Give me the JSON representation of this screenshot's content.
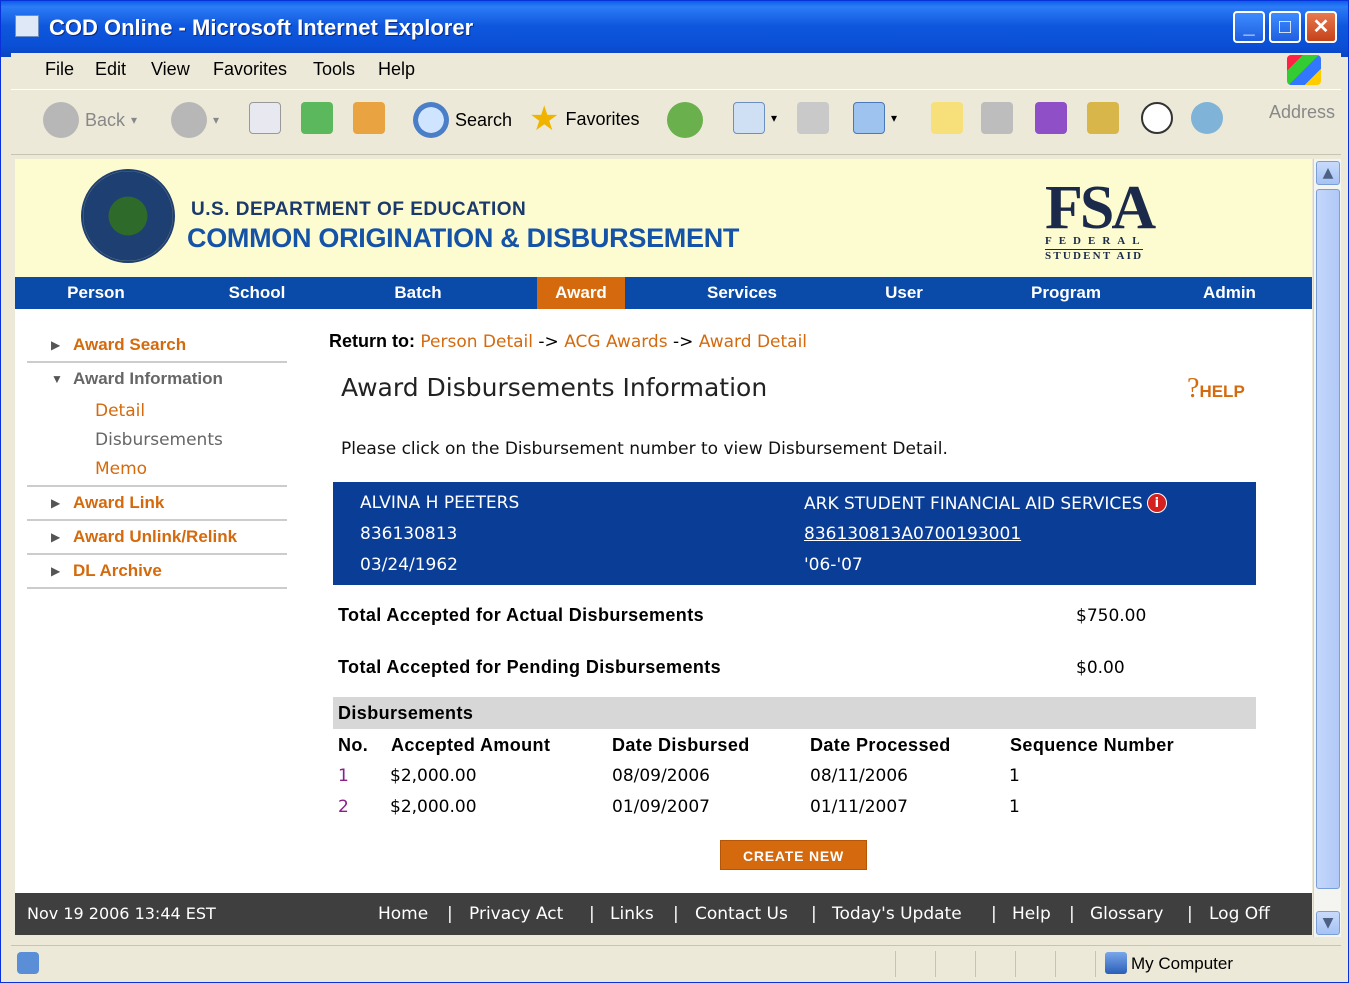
{
  "window": {
    "title": "COD Online - Microsoft Internet Explorer",
    "controls": [
      "minimize",
      "maximize",
      "close"
    ]
  },
  "menubar": {
    "items": [
      "File",
      "Edit",
      "View",
      "Favorites",
      "Tools",
      "Help"
    ]
  },
  "toolbar": {
    "back_label": "Back",
    "search_label": "Search",
    "favorites_label": "Favorites",
    "address_label": "Address"
  },
  "banner": {
    "department": "U.S. DEPARTMENT OF EDUCATION",
    "system_name": "COMMON ORIGINATION & DISBURSEMENT",
    "logo": {
      "big": "FSA",
      "line1": "FEDERAL",
      "line2": "STUDENT AID"
    }
  },
  "nav": {
    "items": [
      {
        "label": "Person"
      },
      {
        "label": "School"
      },
      {
        "label": "Batch"
      },
      {
        "label": "Award"
      },
      {
        "label": "Services"
      },
      {
        "label": "User"
      },
      {
        "label": "Program"
      },
      {
        "label": "Admin"
      }
    ],
    "active": "Award"
  },
  "sidebar": {
    "award_search": "Award Search",
    "award_information": "Award Information",
    "sub": [
      "Detail",
      "Disbursements",
      "Memo"
    ],
    "award_link": "Award Link",
    "award_unlink": "Award Unlink/Relink",
    "dl_archive": "DL Archive"
  },
  "breadcrumb": {
    "prefix": "Return to:",
    "items": [
      "Person Detail",
      "ACG Awards",
      "Award Detail"
    ],
    "separator": "->"
  },
  "page": {
    "title": "Award Disbursements Information",
    "help": "HELP",
    "instructions": "Please click on the Disbursement number to view Disbursement Detail."
  },
  "student": {
    "name": "ALVINA H PEETERS",
    "ssn": "836130813",
    "dob": "03/24/1962",
    "school": "ARK STUDENT FINANCIAL AID SERVICES",
    "award_id": "836130813A0700193001",
    "award_year": "'06-'07"
  },
  "totals": {
    "actual_label": "Total Accepted for Actual Disbursements",
    "actual_value": "$750.00",
    "pending_label": "Total Accepted for Pending Disbursements",
    "pending_value": "$0.00"
  },
  "disbursements": {
    "header": "Disbursements",
    "columns": [
      "No.",
      "Accepted Amount",
      "Date Disbursed",
      "Date Processed",
      "Sequence Number"
    ],
    "rows": [
      [
        "1",
        "$2,000.00",
        "08/09/2006",
        "08/11/2006",
        "1"
      ],
      [
        "2",
        "$2,000.00",
        "01/09/2007",
        "01/11/2007",
        "1"
      ]
    ],
    "create_label": "CREATE NEW"
  },
  "footer": {
    "timestamp": "Nov 19 2006 13:44 EST",
    "links": [
      "Home",
      "Privacy Act",
      "Links",
      "Contact Us",
      "Today's Update",
      "Help",
      "Glossary",
      "Log Off"
    ]
  },
  "statusbar": {
    "zone": "My Computer"
  },
  "colors": {
    "nav_bg": "#0a4aa8",
    "accent_orange": "#d46a0d",
    "student_box": "#0a3d96",
    "banner_bg": "#fdfbd0",
    "footer_bg": "#3f3f3f"
  }
}
